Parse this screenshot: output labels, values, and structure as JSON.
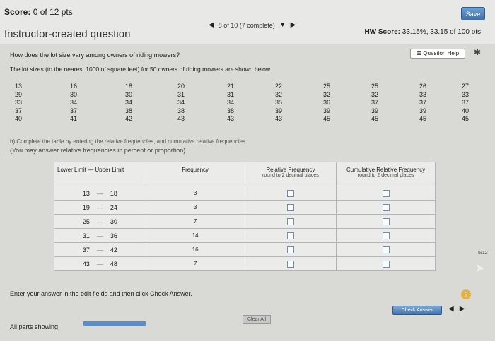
{
  "header": {
    "score_label": "Score:",
    "score_value": "0 of 12 pts",
    "save_label": "Save",
    "nav_progress": "8 of 10 (7 complete)",
    "hw_score_label": "HW Score:",
    "hw_score_value": "33.15%, 33.15 of 100 pts",
    "title": "Instructor-created question",
    "question_help": "Question Help"
  },
  "question": {
    "line1": "How does the lot size vary among owners of riding mowers?",
    "line2": "The lot sizes (to the nearest 1000 of square feet) for 50 owners of riding mowers are shown below.",
    "data_columns": [
      [
        "13",
        "29",
        "33",
        "37",
        "40"
      ],
      [
        "16",
        "30",
        "34",
        "37",
        "41"
      ],
      [
        "18",
        "30",
        "34",
        "38",
        "42"
      ],
      [
        "20",
        "31",
        "34",
        "38",
        "43"
      ],
      [
        "21",
        "31",
        "34",
        "38",
        "43"
      ],
      [
        "22",
        "32",
        "35",
        "39",
        "43"
      ],
      [
        "25",
        "32",
        "36",
        "39",
        "45"
      ],
      [
        "25",
        "32",
        "37",
        "39",
        "45"
      ],
      [
        "26",
        "33",
        "37",
        "39",
        "45"
      ],
      [
        "27",
        "33",
        "37",
        "40",
        "45"
      ]
    ],
    "instruction1": "b) Complete the table by entering the relative frequencies, and cumulative relative frequencies",
    "instruction2": "(You may answer relative frequencies in percent or proportion)."
  },
  "table": {
    "header_limits": "Lower Limit — Upper Limit",
    "header_frequency": "Frequency",
    "header_rel": "Relative Frequency",
    "header_rel_sub": "round to 2 decimal places",
    "header_cum": "Cumulative Relative Frequency",
    "header_cum_sub": "round to 2 decimal places",
    "rows": [
      {
        "lower": "13",
        "upper": "18",
        "freq": "3"
      },
      {
        "lower": "19",
        "upper": "24",
        "freq": "3"
      },
      {
        "lower": "25",
        "upper": "30",
        "freq": "7"
      },
      {
        "lower": "31",
        "upper": "36",
        "freq": "14"
      },
      {
        "lower": "37",
        "upper": "42",
        "freq": "16"
      },
      {
        "lower": "43",
        "upper": "48",
        "freq": "7"
      }
    ]
  },
  "footer": {
    "enter_text": "Enter your answer in the edit fields and then click Check Answer.",
    "clear_all": "Clear All",
    "check_answer": "Check Answer",
    "all_parts": "All parts showing",
    "side_tab": "5/12"
  }
}
